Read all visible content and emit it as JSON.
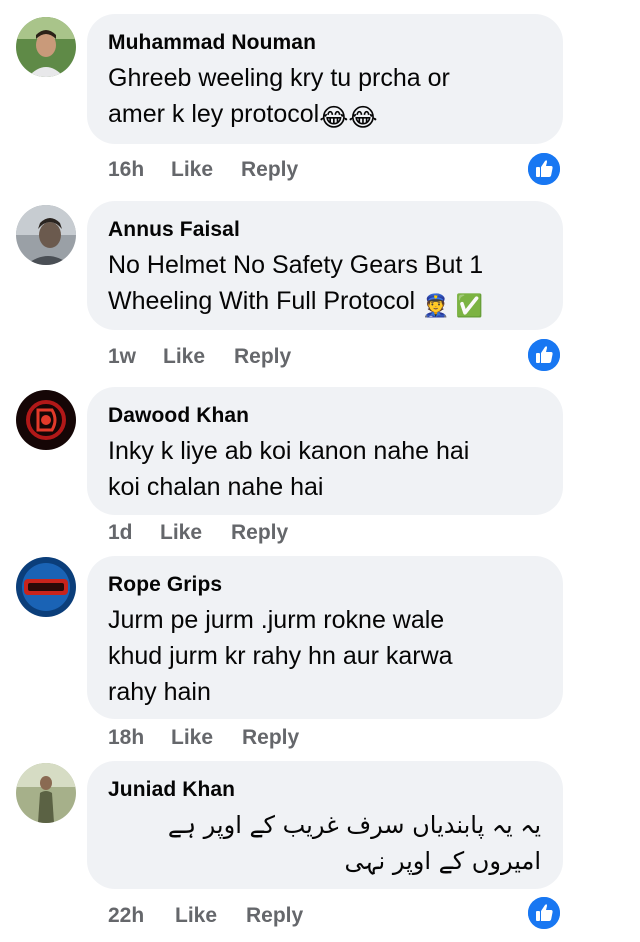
{
  "comments": [
    {
      "author": "Muhammad Nouman",
      "lines": [
        "Ghreeb weeling kry tu prcha or",
        "amer k ley protocol"
      ],
      "trailing_emoji": "😂😂",
      "time": "16h",
      "like_label": "Like",
      "reply_label": "Reply",
      "reaction_icon": "like-reaction-icon",
      "avatar_color": "#6b8a4a"
    },
    {
      "author": "Annus Faisal",
      "lines": [
        "No Helmet No Safety Gears But 1",
        "Wheeling With Full Protocol "
      ],
      "trailing_emoji": "👮 ✅",
      "time": "1w",
      "like_label": "Like",
      "reply_label": "Reply",
      "reaction_icon": "like-reaction-icon",
      "avatar_color": "#8c8f94"
    },
    {
      "author": "Dawood Khan",
      "lines": [
        "Inky k liye ab koi kanon nahe hai",
        "koi chalan nahe hai"
      ],
      "trailing_emoji": "",
      "time": "1d",
      "like_label": "Like",
      "reply_label": "Reply",
      "reaction_icon": "",
      "avatar_color": "#2a0d0d"
    },
    {
      "author": "Rope Grips",
      "lines": [
        "Jurm pe jurm .jurm rokne wale",
        "khud jurm kr rahy hn aur karwa",
        "rahy hain"
      ],
      "trailing_emoji": "",
      "time": "18h",
      "like_label": "Like",
      "reply_label": "Reply",
      "reaction_icon": "",
      "avatar_color": "#1c5fa8"
    },
    {
      "author": "Juniad Khan",
      "lines": [
        "یہ یہ پابندیاں سرف غریب کے اوپر ہے",
        "امیروں کے اوپر نہی"
      ],
      "trailing_emoji": "",
      "time": "22h",
      "like_label": "Like",
      "reply_label": "Reply",
      "reaction_icon": "like-reaction-icon",
      "avatar_color": "#7a8a5a"
    }
  ],
  "colors": {
    "bubble": "#f0f2f5",
    "meta": "#65676b",
    "text": "#050505",
    "like_blue": "#1877f2"
  }
}
